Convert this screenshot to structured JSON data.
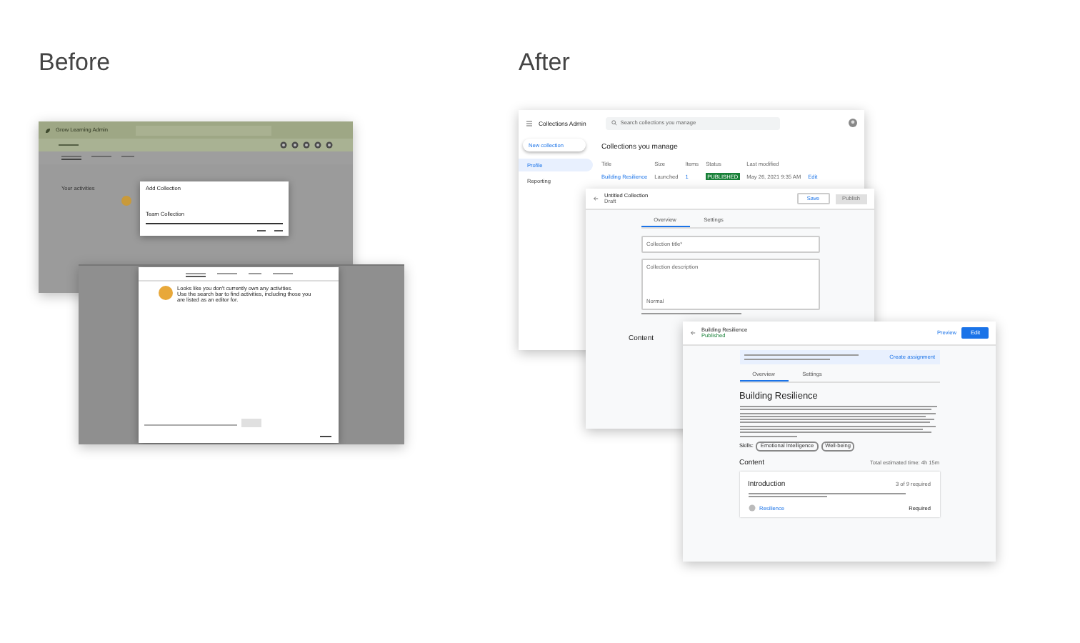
{
  "before": {
    "heading": "Before",
    "admin_window": {
      "app_title": "Grow Learning Admin",
      "section_title": "Your activities",
      "dialog": {
        "title": "Add Collection",
        "field_value": "Team Collection"
      }
    },
    "picker_window": {
      "message": [
        "Looks like you don't currently own any activities.",
        "Use the search bar to find activities, including those you are listed as an editor for."
      ]
    }
  },
  "after": {
    "heading": "After",
    "admin": {
      "app_title": "Collections Admin",
      "search_placeholder": "Search collections you manage",
      "new_button": "New collection",
      "nav": [
        {
          "label": "Profile",
          "selected": true
        },
        {
          "label": "Reporting",
          "selected": false
        }
      ],
      "title": "Collections you manage",
      "columns": [
        "Title",
        "Size",
        "Items",
        "Status",
        "Last modified"
      ],
      "rows": [
        {
          "title": "Building Resilience",
          "size": "Launched",
          "items": "1",
          "status": "PUBLISHED",
          "modified": "May 26, 2021 9:35 AM",
          "action": "Edit"
        }
      ]
    },
    "editor": {
      "title": "Untitled Collection",
      "status": "Draft",
      "save_button": "Save",
      "publish_button": "Publish",
      "tabs": [
        {
          "label": "Overview",
          "selected": true
        },
        {
          "label": "Settings",
          "selected": false
        }
      ],
      "title_placeholder": "Collection title*",
      "description_placeholder": "Collection description",
      "text_style": "Normal",
      "content_heading": "Content"
    },
    "viewer": {
      "title": "Building Resilience",
      "status": "Published",
      "preview_button": "Preview",
      "edit_button": "Edit",
      "banner_action": "Create assignment",
      "tabs": [
        {
          "label": "Overview",
          "selected": true
        },
        {
          "label": "Settings",
          "selected": false
        }
      ],
      "heading": "Building Resilience",
      "skills_label": "Skills:",
      "skills": [
        "Emotional Intelligence",
        "Well-being"
      ],
      "content_heading": "Content",
      "total_time": "Total estimated time: 4h 15m",
      "card": {
        "title": "Introduction",
        "progress": "3 of 9 required",
        "item_title": "Resilience",
        "item_badge": "Required"
      }
    }
  }
}
